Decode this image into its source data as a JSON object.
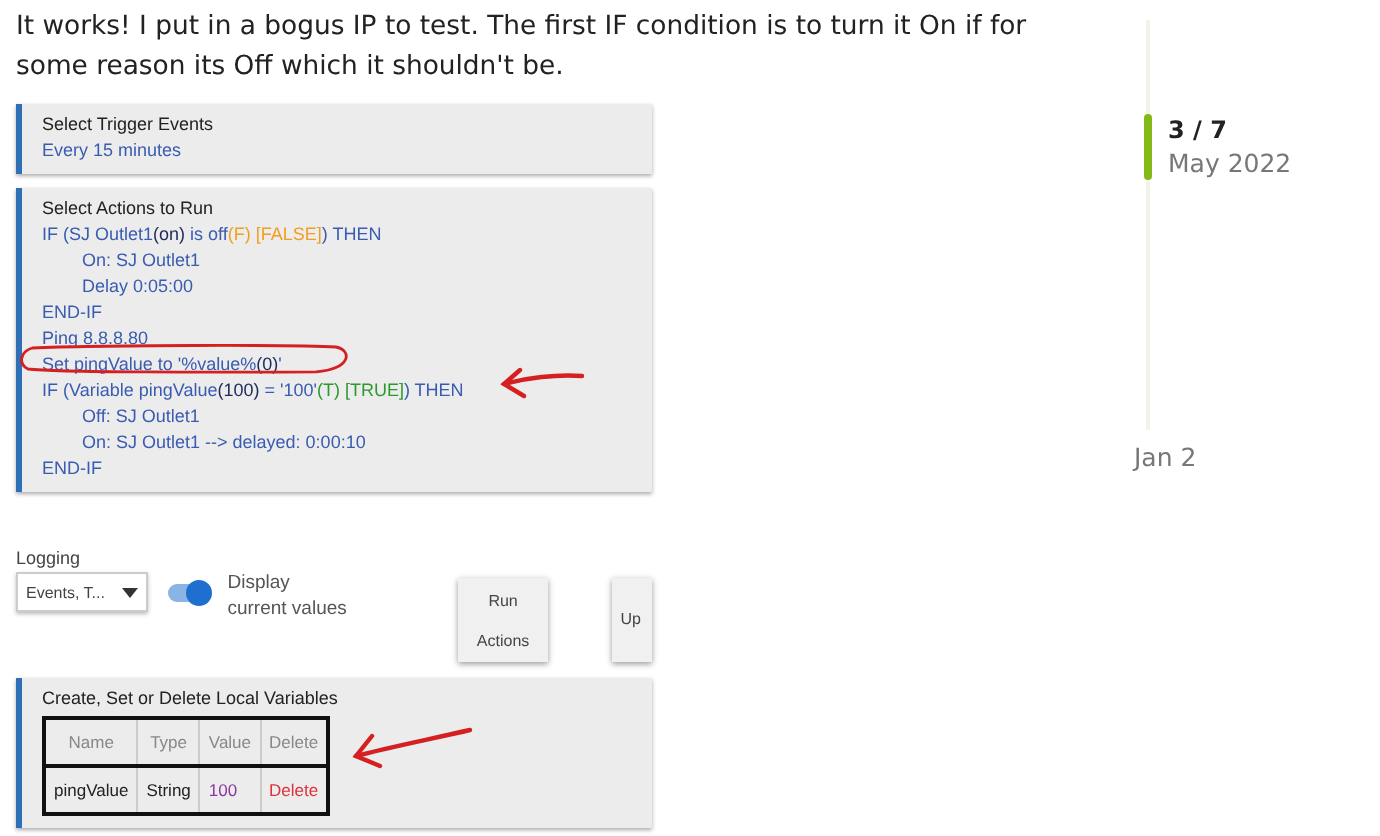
{
  "post": {
    "text": "It works! I put in a bogus IP to test. The first IF condition is to turn it On if for some reason its Off which it shouldn't be."
  },
  "screenshot": {
    "trigger_panel": {
      "title": "Select Trigger Events",
      "value": "Every 15 minutes"
    },
    "actions_panel": {
      "title": "Select Actions to Run",
      "lines": [
        {
          "segments": [
            {
              "text": "IF (SJ Outlet1",
              "kind": "code"
            },
            {
              "text": "(on)",
              "kind": "state"
            },
            {
              "text": " is off",
              "kind": "code"
            },
            {
              "text": "(F) [FALSE]",
              "kind": "false"
            },
            {
              "text": ") THEN",
              "kind": "code"
            }
          ],
          "children": [
            {
              "segments": [
                {
                  "text": "On: SJ Outlet1",
                  "kind": "code"
                }
              ]
            },
            {
              "segments": [
                {
                  "text": "Delay 0:05:00",
                  "kind": "code"
                }
              ]
            }
          ]
        },
        {
          "segments": [
            {
              "text": "END-IF",
              "kind": "code"
            }
          ]
        },
        {
          "segments": [
            {
              "text": "Ping 8.8.8.80",
              "kind": "code"
            }
          ]
        },
        {
          "segments": [
            {
              "text": "Set pingValue to '%value%",
              "kind": "code"
            },
            {
              "text": "(0)",
              "kind": "state"
            },
            {
              "text": "'",
              "kind": "code"
            }
          ]
        },
        {
          "segments": [
            {
              "text": "IF (Variable pingValue",
              "kind": "code"
            },
            {
              "text": "(100)",
              "kind": "state"
            },
            {
              "text": " = '100'",
              "kind": "code"
            },
            {
              "text": "(T) [TRUE]",
              "kind": "true"
            },
            {
              "text": ") THEN",
              "kind": "code"
            }
          ],
          "children": [
            {
              "segments": [
                {
                  "text": "Off: SJ Outlet1",
                  "kind": "code"
                }
              ]
            },
            {
              "segments": [
                {
                  "text": "On: SJ Outlet1 --> delayed: 0:00:10",
                  "kind": "code"
                }
              ]
            }
          ]
        },
        {
          "segments": [
            {
              "text": "END-IF",
              "kind": "code"
            }
          ]
        }
      ]
    },
    "logging": {
      "label": "Logging",
      "dropdown": "Events, T...",
      "toggle": {
        "label": "Display current values",
        "on": true
      }
    },
    "buttons": [
      {
        "lines": [
          "Run",
          "Actions"
        ]
      },
      {
        "lines": [
          "Up"
        ]
      }
    ],
    "variables_panel": {
      "title": "Create, Set or Delete Local Variables",
      "columns": [
        "Name",
        "Type",
        "Value",
        "Delete"
      ],
      "rows": [
        {
          "name": "pingValue",
          "type": "String",
          "value": "100",
          "delete": "Delete"
        }
      ]
    }
  },
  "timeline": {
    "position": "3 / 7",
    "date": "May 2022",
    "end": "Jan 2"
  }
}
